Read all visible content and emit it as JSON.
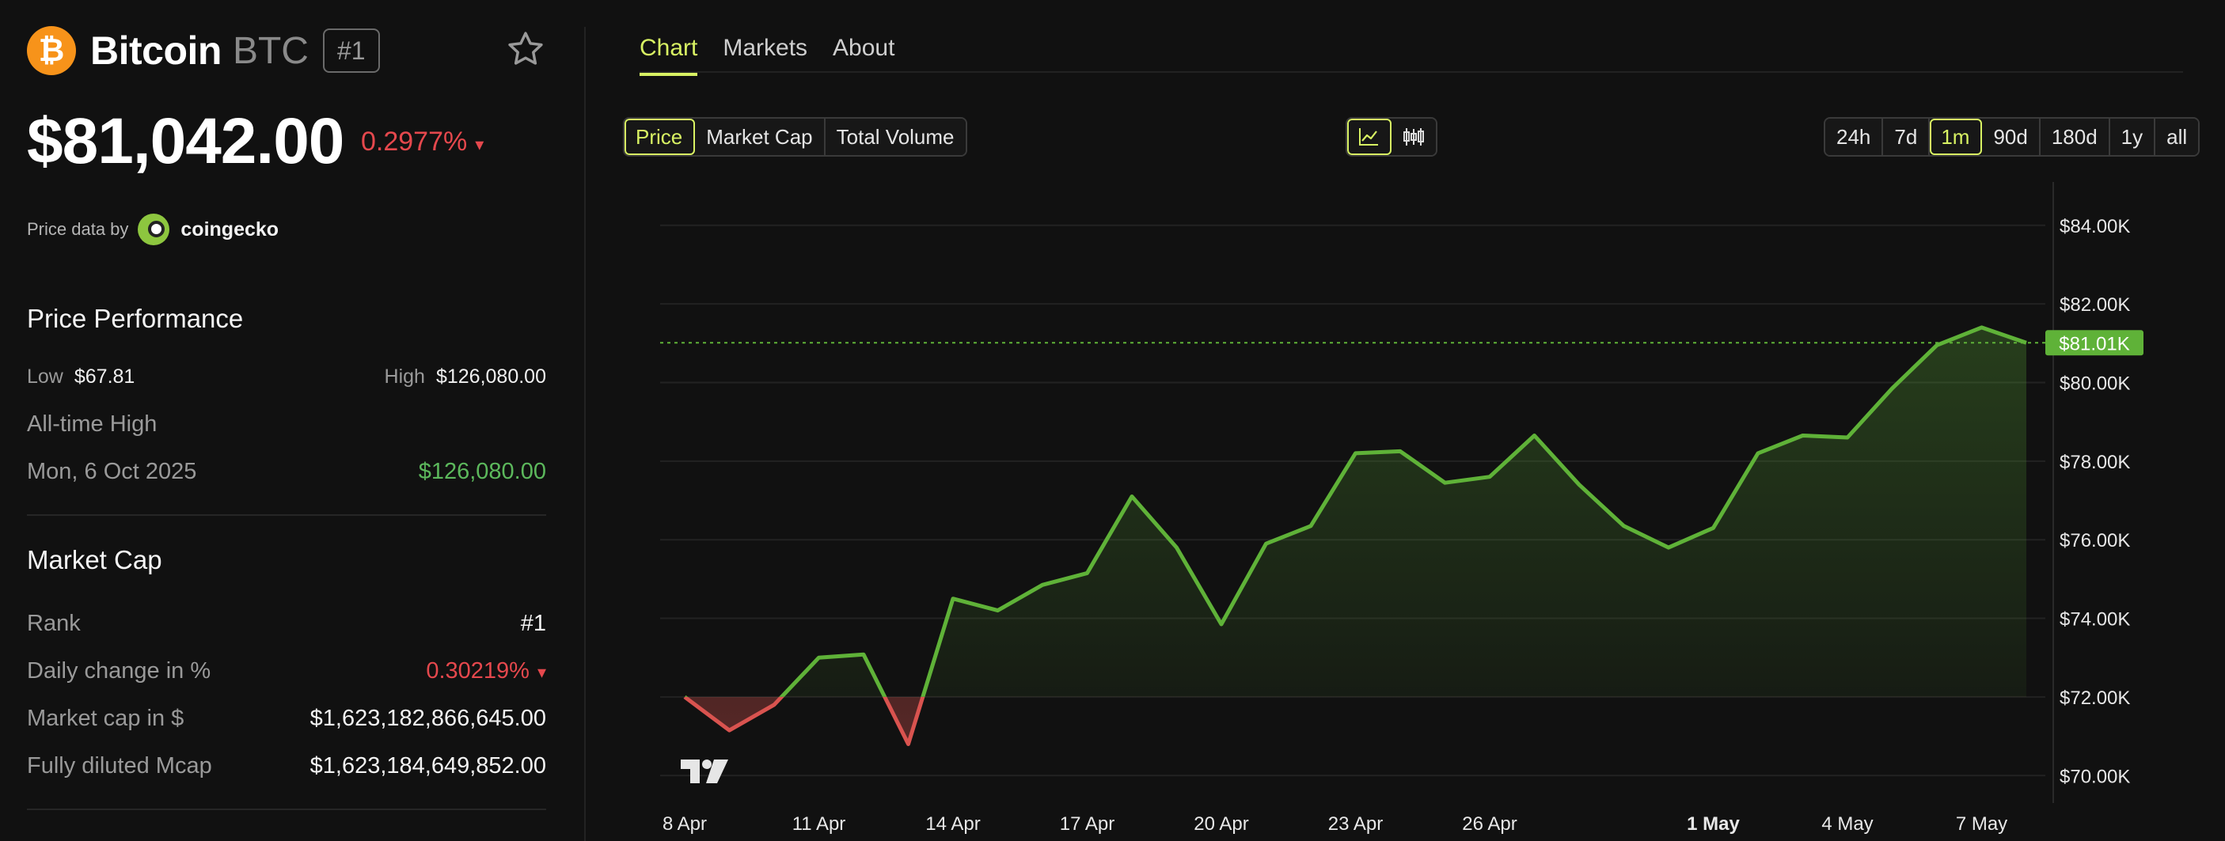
{
  "coin": {
    "logo_glyph": "₿",
    "name": "Bitcoin",
    "symbol": "BTC",
    "rank_badge": "#1",
    "price": "$81,042.00",
    "change_24h": "0.2977%",
    "change_arrow": "▾",
    "price_data_by": "Price data by",
    "provider": "coingecko",
    "icons": {
      "logo": "bitcoin-logo-icon",
      "favorite": "star-icon",
      "provider": "coingecko-logo-icon"
    }
  },
  "performance": {
    "title": "Price Performance",
    "low_label": "Low",
    "low_value": "$67.81",
    "high_label": "High",
    "high_value": "$126,080.00",
    "ath_label": "All-time High",
    "ath_date": "Mon, 6 Oct 2025",
    "ath_value": "$126,080.00"
  },
  "market_cap": {
    "title": "Market Cap",
    "rows": [
      {
        "label": "Rank",
        "value": "#1"
      },
      {
        "label": "Daily change in %",
        "value": "0.30219%",
        "arrow": "▾"
      },
      {
        "label": "Market cap in $",
        "value": "$1,623,182,866,645.00"
      },
      {
        "label": "Fully diluted Mcap",
        "value": "$1,623,184,649,852.00"
      }
    ]
  },
  "tabs": [
    {
      "label": "Chart",
      "active": true
    },
    {
      "label": "Markets"
    },
    {
      "label": "About"
    }
  ],
  "metric_options": [
    {
      "label": "Price",
      "selected": true
    },
    {
      "label": "Market Cap"
    },
    {
      "label": "Total Volume"
    }
  ],
  "chart_type_options": [
    {
      "icon": "line-chart-icon",
      "selected": true
    },
    {
      "icon": "candlestick-chart-icon"
    }
  ],
  "range_options": [
    {
      "label": "24h"
    },
    {
      "label": "7d"
    },
    {
      "label": "1m",
      "selected": true
    },
    {
      "label": "90d"
    },
    {
      "label": "180d"
    },
    {
      "label": "1y"
    },
    {
      "label": "all"
    }
  ],
  "colors": {
    "accent": "#d8f263",
    "up": "#5cb85c",
    "down": "#e5484d",
    "line_up": "#5fb238",
    "line_down": "#d9534f"
  },
  "chart_data": {
    "type": "line",
    "series": [
      {
        "values": [
          72000,
          71150,
          71800,
          73000,
          73080,
          70800,
          74500,
          74200,
          74850,
          75150,
          77100,
          75800,
          73850,
          75900,
          76350,
          78200,
          78250,
          77450,
          77600,
          78650,
          77400,
          76350,
          75800,
          76300,
          78200,
          78650,
          78600,
          79850,
          80950,
          81400,
          81010
        ]
      }
    ],
    "baseline": 72000,
    "current_label": "$81.01K",
    "current_value": 81010,
    "ylim": [
      69200,
      84700
    ],
    "y_ticks": [
      {
        "value": 84000,
        "label": "$84.00K"
      },
      {
        "value": 82000,
        "label": "$82.00K"
      },
      {
        "value": 80000,
        "label": "$80.00K"
      },
      {
        "value": 78000,
        "label": "$78.00K"
      },
      {
        "value": 76000,
        "label": "$76.00K"
      },
      {
        "value": 74000,
        "label": "$74.00K"
      },
      {
        "value": 72000,
        "label": "$72.00K"
      },
      {
        "value": 70000,
        "label": "$70.00K"
      }
    ],
    "x_ticks": [
      {
        "index": 0,
        "label": "8 Apr"
      },
      {
        "index": 3,
        "label": "11 Apr"
      },
      {
        "index": 6,
        "label": "14 Apr"
      },
      {
        "index": 9,
        "label": "17 Apr"
      },
      {
        "index": 12,
        "label": "20 Apr"
      },
      {
        "index": 15,
        "label": "23 Apr"
      },
      {
        "index": 18,
        "label": "26 Apr"
      },
      {
        "index": 23,
        "label": "1 May",
        "bold": true
      },
      {
        "index": 26,
        "label": "4 May"
      },
      {
        "index": 29,
        "label": "7 May"
      }
    ],
    "grid": true,
    "watermark_icon": "tradingview-logo-icon"
  }
}
